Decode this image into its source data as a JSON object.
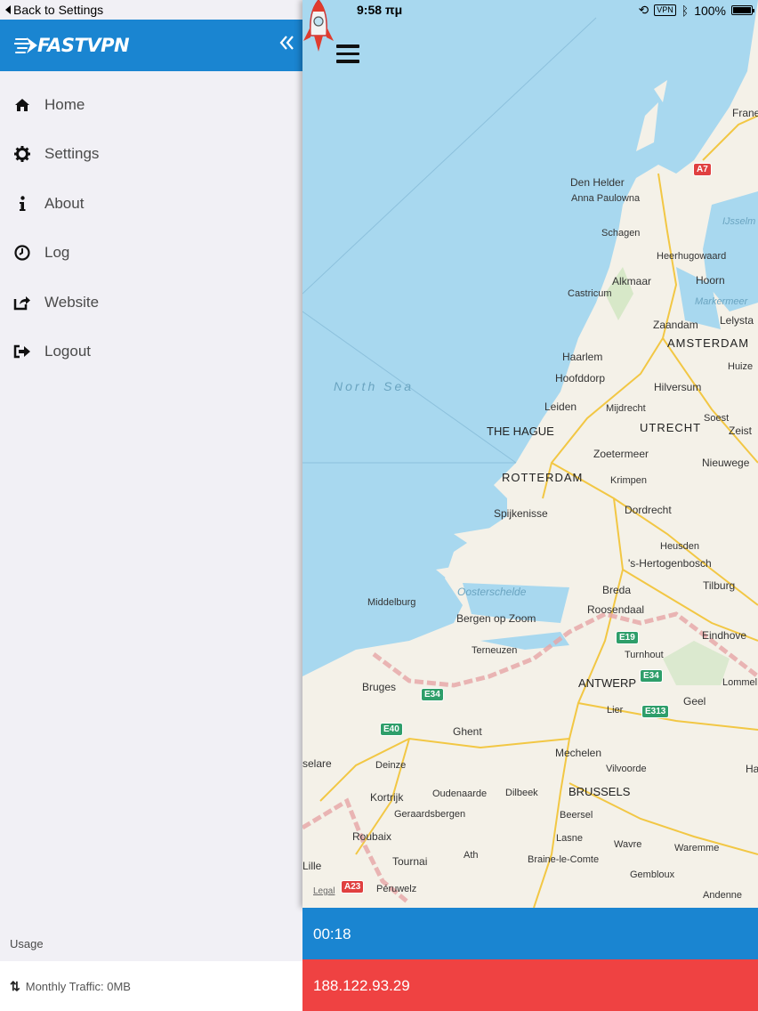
{
  "status_bar": {
    "back_label": "Back to Settings",
    "time": "9:58 πμ",
    "vpn": "VPN",
    "battery": "100%"
  },
  "sidebar": {
    "logo_text": "FASTVPN",
    "collapse_icon": "double-chevron-left-icon",
    "items": [
      {
        "label": "Home",
        "icon": "home-icon"
      },
      {
        "label": "Settings",
        "icon": "gear-icon"
      },
      {
        "label": "About",
        "icon": "info-icon"
      },
      {
        "label": "Log",
        "icon": "clock-icon"
      },
      {
        "label": "Website",
        "icon": "share-icon"
      },
      {
        "label": "Logout",
        "icon": "sign-out-icon"
      }
    ],
    "usage_label": "Usage",
    "monthly_traffic": "Monthly Traffic: 0MB"
  },
  "map": {
    "menu_icon": "hamburger-menu-icon",
    "labels": {
      "france": "Frane",
      "den_helder": "Den Helder",
      "anna_paulowna": "Anna Paulowna",
      "schagen": "Schagen",
      "heerhugowaard": "Heerhugowaard",
      "alkmaar": "Alkmaar",
      "castricum": "Castricum",
      "hoorn": "Hoorn",
      "markermeer": "Markermeer",
      "ijsselm": "IJsselm",
      "lelystad": "Lelysta",
      "zaandam": "Zaandam",
      "amsterdam": "AMSTERDAM",
      "haarlem": "Haarlem",
      "huizen": "Huize",
      "hoofddorp": "Hoofddorp",
      "hilversum": "Hilversum",
      "north_sea": "North Sea",
      "leiden": "Leiden",
      "mijdrecht": "Mijdrecht",
      "soest": "Soest",
      "zeist": "Zeist",
      "the_hague": "THE HAGUE",
      "utrecht": "UTRECHT",
      "zoetermeer": "Zoetermeer",
      "nieuwegein": "Nieuwege",
      "rotterdam": "ROTTERDAM",
      "krimpen": "Krimpen",
      "spijkenisse": "Spijkenisse",
      "dordrecht": "Dordrecht",
      "heusden": "Heusden",
      "hertogenbosch": "'s-Hertogenbosch",
      "oosterschelde": "Oosterschelde",
      "breda": "Breda",
      "tilburg": "Tilburg",
      "middelburg": "Middelburg",
      "bergen_op_zoom": "Bergen op Zoom",
      "roosendaal": "Roosendaal",
      "eindhoven": "Eindhove",
      "terneuzen": "Terneuzen",
      "turnhout": "Turnhout",
      "bruges": "Bruges",
      "antwerp": "ANTWERP",
      "lommel": "Lommel",
      "lier": "Lier",
      "geel": "Geel",
      "ghent": "Ghent",
      "mechelen": "Mechelen",
      "selare": "selare",
      "deinze": "Deinze",
      "vilvoorde": "Vilvoorde",
      "kortrijk": "Kortrijk",
      "oudenaarde": "Oudenaarde",
      "dilbeek": "Dilbeek",
      "brussels": "BRUSSELS",
      "geraardsbergen": "Geraardsbergen",
      "beersel": "Beersel",
      "roubaix": "Roubaix",
      "lasne": "Lasne",
      "wavre": "Wavre",
      "waremme": "Waremme",
      "tournai": "Tournai",
      "ath": "Ath",
      "braine": "Braine-le-Comte",
      "lille": "Lille",
      "gembloux": "Gembloux",
      "peruwelz": "Péruwelz",
      "andenne": "Andenne",
      "ha": "Ha"
    },
    "roads": {
      "a7": "A7",
      "e19": "E19",
      "e34a": "E34",
      "e34b": "E34",
      "e313": "E313",
      "e40": "E40",
      "a23": "A23"
    },
    "legal": "Legal",
    "marker_icon": "rocket-icon"
  },
  "connection": {
    "timer": "00:18",
    "ip_address": "188.122.93.29"
  },
  "colors": {
    "brand_blue": "#1a85d1",
    "ip_red": "#ef4242",
    "sea": "#a8d8ef",
    "land": "#f4f1e8"
  }
}
